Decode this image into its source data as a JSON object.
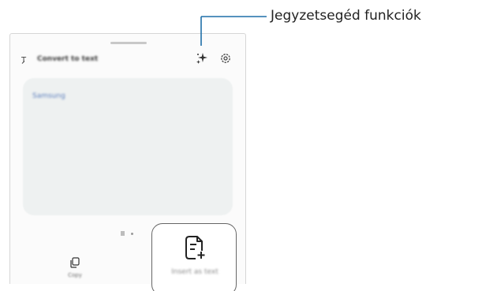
{
  "annotation": {
    "caption": "Jegyzetsegéd funkciók",
    "line_color": "#1f6fa8"
  },
  "toolbar": {
    "convert_label": "Convert to text",
    "convert_icon": "text-convert-icon",
    "assist_icon": "sparkle-icon",
    "settings_icon": "gear-icon"
  },
  "note": {
    "text": "Samsung"
  },
  "bottom_bar": {
    "copy_label": "Copy",
    "copy_icon": "copy-icon",
    "save_label": "Insert as text",
    "save_icon": "note-add-icon"
  },
  "colors": {
    "note_background": "#eef1f1",
    "note_text": "#5c7fbd"
  }
}
